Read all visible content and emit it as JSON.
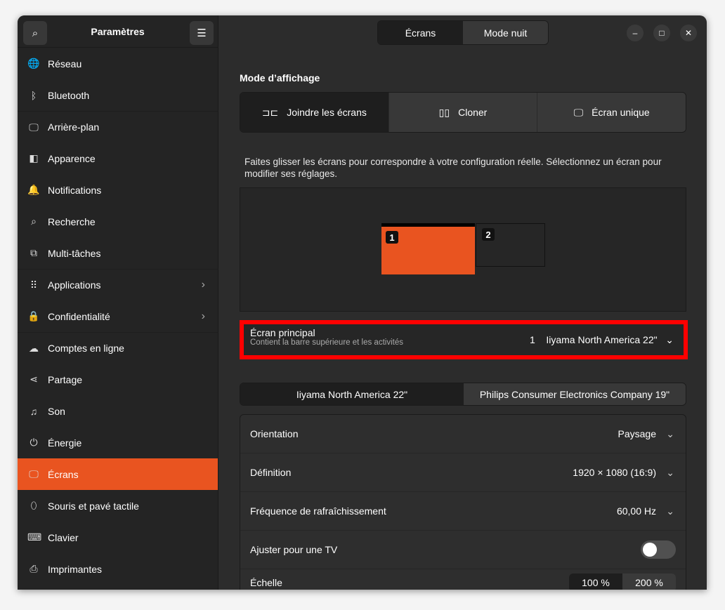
{
  "sidebar": {
    "title": "Paramètres",
    "items": [
      {
        "label": "Réseau",
        "icon": "globe-icon"
      },
      {
        "label": "Bluetooth",
        "icon": "bluetooth-icon"
      },
      {
        "label": "Arrière-plan",
        "icon": "background-icon"
      },
      {
        "label": "Apparence",
        "icon": "appearance-icon"
      },
      {
        "label": "Notifications",
        "icon": "bell-icon"
      },
      {
        "label": "Recherche",
        "icon": "search-icon"
      },
      {
        "label": "Multi-tâches",
        "icon": "multitask-icon"
      },
      {
        "label": "Applications",
        "icon": "apps-icon"
      },
      {
        "label": "Confidentialité",
        "icon": "lock-icon"
      },
      {
        "label": "Comptes en ligne",
        "icon": "cloud-icon"
      },
      {
        "label": "Partage",
        "icon": "share-icon"
      },
      {
        "label": "Son",
        "icon": "music-icon"
      },
      {
        "label": "Énergie",
        "icon": "power-icon"
      },
      {
        "label": "Écrans",
        "icon": "display-icon"
      },
      {
        "label": "Souris et pavé tactile",
        "icon": "mouse-icon"
      },
      {
        "label": "Clavier",
        "icon": "keyboard-icon"
      },
      {
        "label": "Imprimantes",
        "icon": "printer-icon"
      }
    ]
  },
  "header": {
    "tabs": [
      "Écrans",
      "Mode nuit"
    ]
  },
  "main": {
    "mode_title": "Mode d’affichage",
    "modes": [
      "Joindre les écrans",
      "Cloner",
      "Écran unique"
    ],
    "description": "Faites glisser les écrans pour correspondre à votre configuration réelle. Sélectionnez un écran pour modifier ses réglages.",
    "monitors": [
      "1",
      "2"
    ],
    "primary": {
      "title": "Écran principal",
      "subtitle": "Contient la barre supérieure et les activités",
      "number": "1",
      "value": "Iiyama North America 22\""
    },
    "monitor_tabs": [
      "Iiyama North America 22\"",
      "Philips Consumer Electronics Company 19\""
    ],
    "rows": [
      {
        "label": "Orientation",
        "value": "Paysage"
      },
      {
        "label": "Définition",
        "value": "1920 × 1080 (16:9)"
      },
      {
        "label": "Fréquence de rafraîchissement",
        "value": "60,00 Hz"
      }
    ],
    "tv": {
      "label": "Ajuster pour une TV",
      "on": false
    },
    "scale": {
      "label": "Échelle",
      "options": [
        "100 %",
        "200 %"
      ]
    }
  },
  "colors": {
    "accent": "#e95420"
  }
}
